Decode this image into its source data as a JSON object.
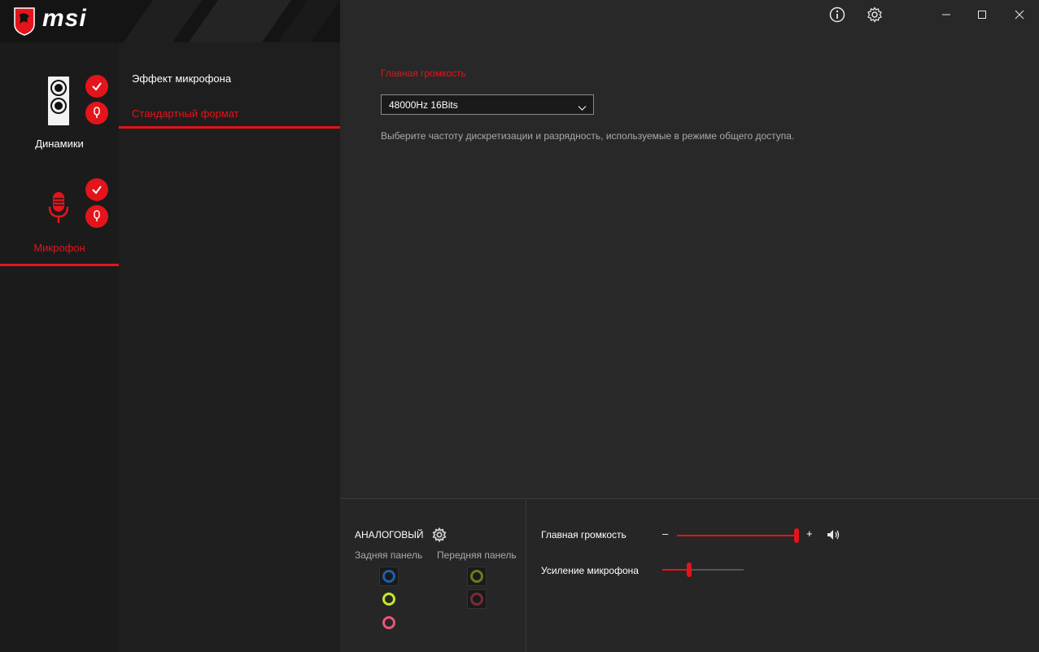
{
  "brand": {
    "logo_text": "msi"
  },
  "colors": {
    "accent": "#e3141b",
    "bg_main": "#282828",
    "bg_sidebar": "#1b1b1b"
  },
  "titlebar": {
    "icons": [
      "info-icon",
      "settings-icon"
    ],
    "controls": [
      "minimize",
      "maximize",
      "close"
    ]
  },
  "devices": [
    {
      "label": "Динамики",
      "icon": "speaker-icon",
      "selected": false
    },
    {
      "label": "Микрофон",
      "icon": "microphone-icon",
      "selected": true
    }
  ],
  "submenu": {
    "items": [
      {
        "label": "Эффект микрофона",
        "selected": false
      },
      {
        "label": "Стандартный формат",
        "selected": true
      }
    ]
  },
  "main": {
    "section_title": "Главная громкость",
    "format_select": {
      "value": "48000Hz 16Bits"
    },
    "description": "Выберите частоту дискретизации и разрядность, используемые в режиме общего доступа."
  },
  "bottom": {
    "analog_label": "АНАЛОГОВЫЙ",
    "back_panel_label": "Задняя панель",
    "front_panel_label": "Передняя панель",
    "back_jacks": [
      "#1f5fa8",
      "#c8e628",
      "#e8557a"
    ],
    "front_jacks": [
      "#6b7a1e",
      "#7a2a3a"
    ],
    "master_volume": {
      "label": "Главная громкость",
      "minus": "–",
      "plus": "+",
      "level": 1.0
    },
    "mic_boost": {
      "label": "Усиление микрофона",
      "level": 0.33
    }
  }
}
